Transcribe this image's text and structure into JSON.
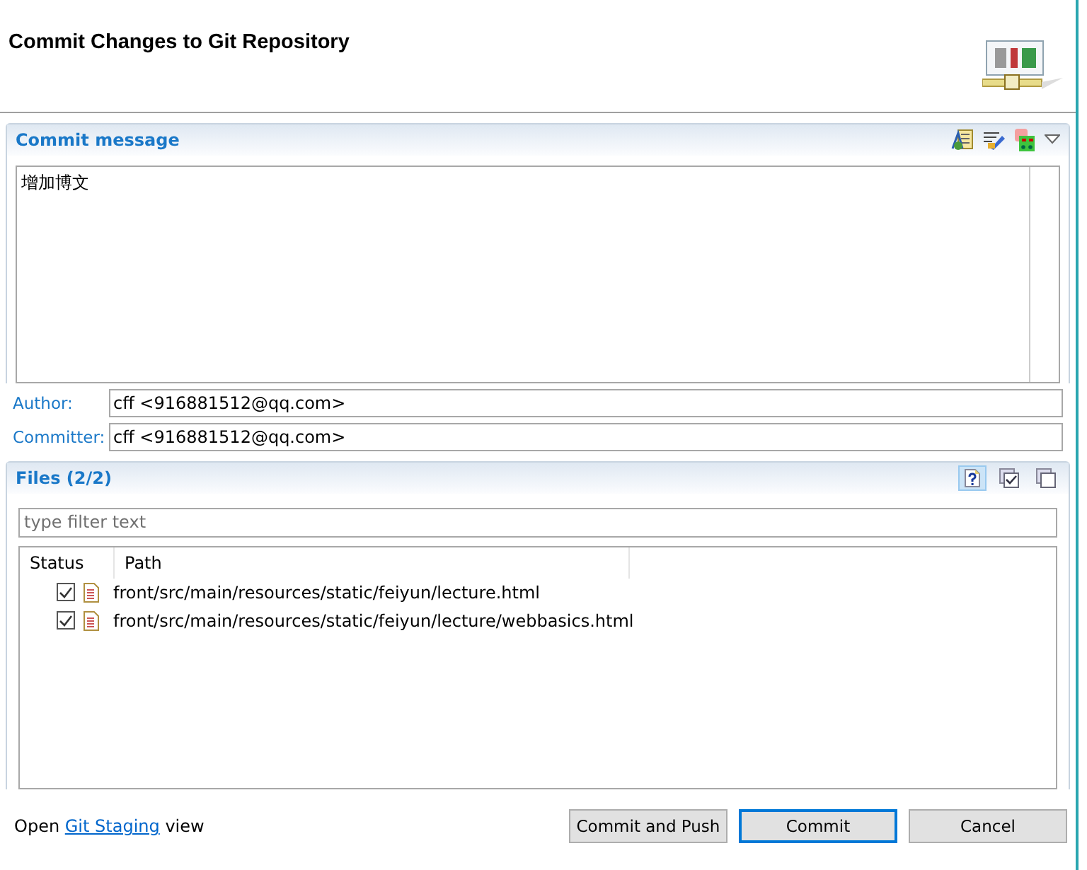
{
  "header": {
    "title": "Commit Changes to Git Repository"
  },
  "commit_message": {
    "title": "Commit message",
    "value": "增加博文"
  },
  "author": {
    "label": "Author:",
    "value": "cff <916881512@qq.com>"
  },
  "committer": {
    "label": "Committer:",
    "value": "cff <916881512@qq.com>"
  },
  "files": {
    "title": "Files (2/2)",
    "filter_placeholder": "type filter text",
    "toolbar": [
      {
        "kind": "untracked",
        "selected": true
      },
      {
        "kind": "check-all",
        "selected": false
      },
      {
        "kind": "uncheck-all",
        "selected": false
      }
    ],
    "columns": [
      "Status",
      "Path"
    ],
    "rows": [
      {
        "checked": true,
        "path": "front/src/main/resources/static/feiyun/lecture.html"
      },
      {
        "checked": true,
        "path": "front/src/main/resources/static/feiyun/lecture/webbasics.html"
      }
    ]
  },
  "footer": {
    "prefix": "Open",
    "link": "Git Staging",
    "suffix": "view"
  },
  "buttons": [
    {
      "label": "Commit and Push",
      "default": false
    },
    {
      "label": "Commit",
      "default": true
    },
    {
      "label": "Cancel",
      "default": false
    }
  ]
}
